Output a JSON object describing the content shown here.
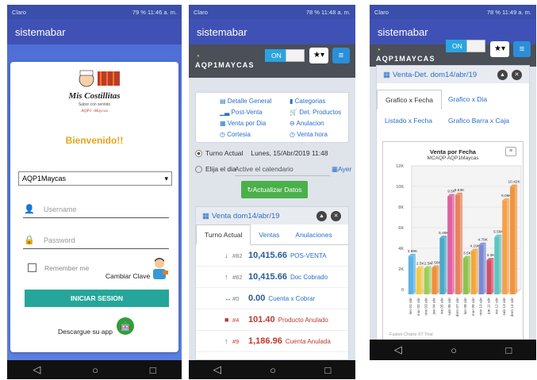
{
  "screen1": {
    "status": {
      "carrier": "Claro",
      "right": "79 % 11:46 a. m."
    },
    "app_title": "sistemabar",
    "logo": {
      "line1": "Mis Costillitas",
      "line2": "Sabor con sentido",
      "line3": "AQP1 -Maycas"
    },
    "welcome": "Bienvenido!!",
    "branch_select": "AQP1Maycas",
    "username_placeholder": "Username",
    "password_placeholder": "Password",
    "remember": "Remember me",
    "change_key": "Cambiar Clave",
    "login_button": "INICIAR SESION",
    "download": "Descargue su app"
  },
  "screen2": {
    "status": {
      "carrier": "Claro",
      "right": "78 % 11:48 a. m."
    },
    "app_title": "sistemabar",
    "brand": "AQP1MAYCAS",
    "toggle": "ON",
    "menu": [
      "Detalle General",
      "Categorias",
      "Post-Venta",
      "Det. Productos",
      "Venta por Dia",
      "Anulacion",
      "Cortesia",
      "Venta hora"
    ],
    "turno_label": "Turno Actual",
    "turno_value": "Lunes, 15/Abr/2019 11:48",
    "elija_label": "Elija el dia",
    "calendar_placeholder": "Active el calendario",
    "ayer": "Ayer",
    "update_button": "Actualizar Datos",
    "panel_title": "Venta dom14/abr/19",
    "tabs": [
      "Turno Actual",
      "Ventas",
      "Anulaciones"
    ],
    "rows": [
      {
        "sym": "↓",
        "count": "#82",
        "value": "10,415.66",
        "label": "POS-VENTA",
        "red": false
      },
      {
        "sym": "↑",
        "count": "#82",
        "value": "10,415.66",
        "label": "Doc Cobrado",
        "red": false
      },
      {
        "sym": "↔",
        "count": "#0",
        "value": "0.00",
        "label": "Cuenta x Cobrar",
        "red": false
      },
      {
        "sym": "■",
        "count": "#4",
        "value": "101.40",
        "label": "Producto Anulado",
        "red": true
      },
      {
        "sym": "↑",
        "count": "#9",
        "value": "1,186.96",
        "label": "Cuenta Anulada",
        "red": true
      }
    ]
  },
  "screen3": {
    "status": {
      "carrier": "Claro",
      "right": "78 % 11:49 a. m."
    },
    "app_title": "sistemabar",
    "brand": "AQP1MAYCAS",
    "toggle": "ON",
    "panel_title": "Venta-Det. dom14/abr/19",
    "tabs": [
      "Grafico x Fecha",
      "Grafico x Dia",
      "Listado x Fecha",
      "Grafico Barra x Caja"
    ],
    "credit": "Fusion Charts XT Trial"
  },
  "chart_data": {
    "type": "bar",
    "title": "Venta por Fecha",
    "subtitle": "MCAQP AQP1Maycas",
    "ylim": [
      0,
      12000
    ],
    "yticks": [
      "0",
      "2K",
      "4K",
      "6K",
      "8K",
      "10K",
      "12K"
    ],
    "categories": [
      "lun 01 abr",
      "mar 02 abr",
      "mie 03 abr",
      "jue 04 abr",
      "vie 05 abr",
      "sab 06 abr",
      "dom 07 abr",
      "lun 08 abr",
      "mar 09 abr",
      "mie 10 abr",
      "jue 11 abr",
      "vie 12 abr",
      "sab 13 abr",
      "dom 14 abr"
    ],
    "values": [
      3690,
      2500,
      2500,
      2580,
      5460,
      9500,
      9630,
      3500,
      4190,
      4790,
      3300,
      5560,
      9080,
      10420
    ],
    "data_labels": [
      "3.69K",
      "2.5K",
      "2.5K",
      "2.58K",
      "5.46K",
      "9.5K",
      "9.63K",
      "3.5K",
      "4.19K",
      "4.79K",
      "3.3K",
      "5.56K",
      "9.08K",
      "10.42K"
    ],
    "colors": [
      "#5ab4e6",
      "#f2c84b",
      "#9acd5a",
      "#f08f3a",
      "#4aa9c9",
      "#e060a0",
      "#e8835a",
      "#8fc34f",
      "#f4a63a",
      "#7a8ad6",
      "#d24f6a",
      "#5fc4c0",
      "#f6a14a",
      "#f0953e"
    ]
  }
}
